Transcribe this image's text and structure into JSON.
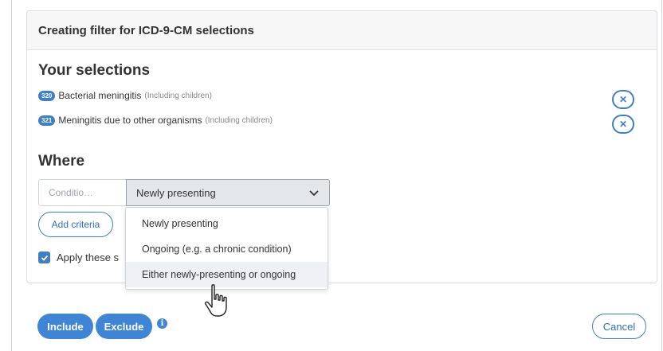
{
  "panel": {
    "title": "Creating filter for ICD-9-CM selections"
  },
  "selections": {
    "heading": "Your selections",
    "items": [
      {
        "code": "320",
        "label": "Bacterial meningitis",
        "note": "(Including children)",
        "remove_icon": "close-icon"
      },
      {
        "code": "321",
        "label": "Meningitis due to other organisms",
        "note": "(Including children)",
        "remove_icon": "close-icon"
      }
    ]
  },
  "where": {
    "heading": "Where",
    "condition_placeholder": "Conditio…",
    "select_value": "Newly presenting",
    "select_icon": "chevron-down-icon",
    "options": [
      "Newly presenting",
      "Ongoing (e.g. a chronic condition)",
      "Either newly-presenting or ongoing"
    ],
    "hovered_option_index": 2,
    "add_criteria_label": "Add criteria",
    "apply_label": "Apply these s",
    "apply_checked": true
  },
  "footer": {
    "include_label": "Include",
    "exclude_label": "Exclude",
    "info_icon": "info-icon",
    "cancel_label": "Cancel"
  },
  "colors": {
    "accent": "#3f85d6",
    "border_accent": "#3f7fc5",
    "hover_bg": "#eef0f3"
  },
  "cursor": "hand-pointer-cursor"
}
